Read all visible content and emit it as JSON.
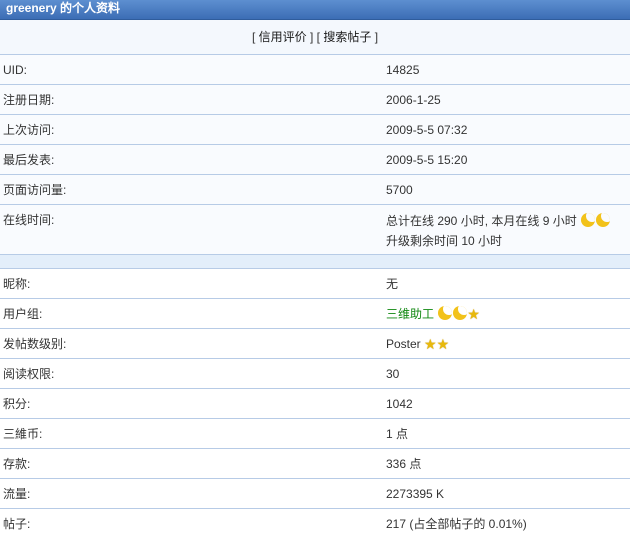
{
  "header": {
    "title": "greenery 的个人资料"
  },
  "links": {
    "open1": "[",
    "credit": "信用评价",
    "close1": "]",
    "open2": "[",
    "search": "搜索帖子",
    "close2": "]"
  },
  "rows": [
    {
      "label": "UID:",
      "value": "14825"
    },
    {
      "label": "注册日期:",
      "value": "2006-1-25"
    },
    {
      "label": "上次访问:",
      "value": "2009-5-5 07:32"
    },
    {
      "label": "最后发表:",
      "value": "2009-5-5 15:20"
    },
    {
      "label": "页面访问量:",
      "value": "5700"
    }
  ],
  "online": {
    "label": "在线时间:",
    "line1": "总计在线 290 小时, 本月在线 9 小时",
    "line2": "升级剩余时间 10 小时"
  },
  "rows2": [
    {
      "label": "昵称:",
      "value": "无"
    },
    {
      "label": "用户组:",
      "value": "三维助工"
    },
    {
      "label": "发帖数级别:",
      "value": "Poster"
    },
    {
      "label": "阅读权限:",
      "value": "30"
    },
    {
      "label": "积分:",
      "value": "1042"
    },
    {
      "label": "三維币:",
      "value": "1 点"
    },
    {
      "label": "存款:",
      "value": "336 点"
    },
    {
      "label": "流量:",
      "value": "2273395 K"
    },
    {
      "label": "帖子:",
      "value": "217 (占全部帖子的 0.01%)"
    }
  ],
  "icons": {
    "online_rank": "moon-icon",
    "group_rank": [
      "moon-icon",
      "moon-icon",
      "star-icon"
    ],
    "post_rank": [
      "star-icon",
      "star-icon"
    ]
  },
  "colors": {
    "title_bar": "#4a7dc2",
    "group_name": "#118811",
    "border": "#b7cbe6"
  }
}
